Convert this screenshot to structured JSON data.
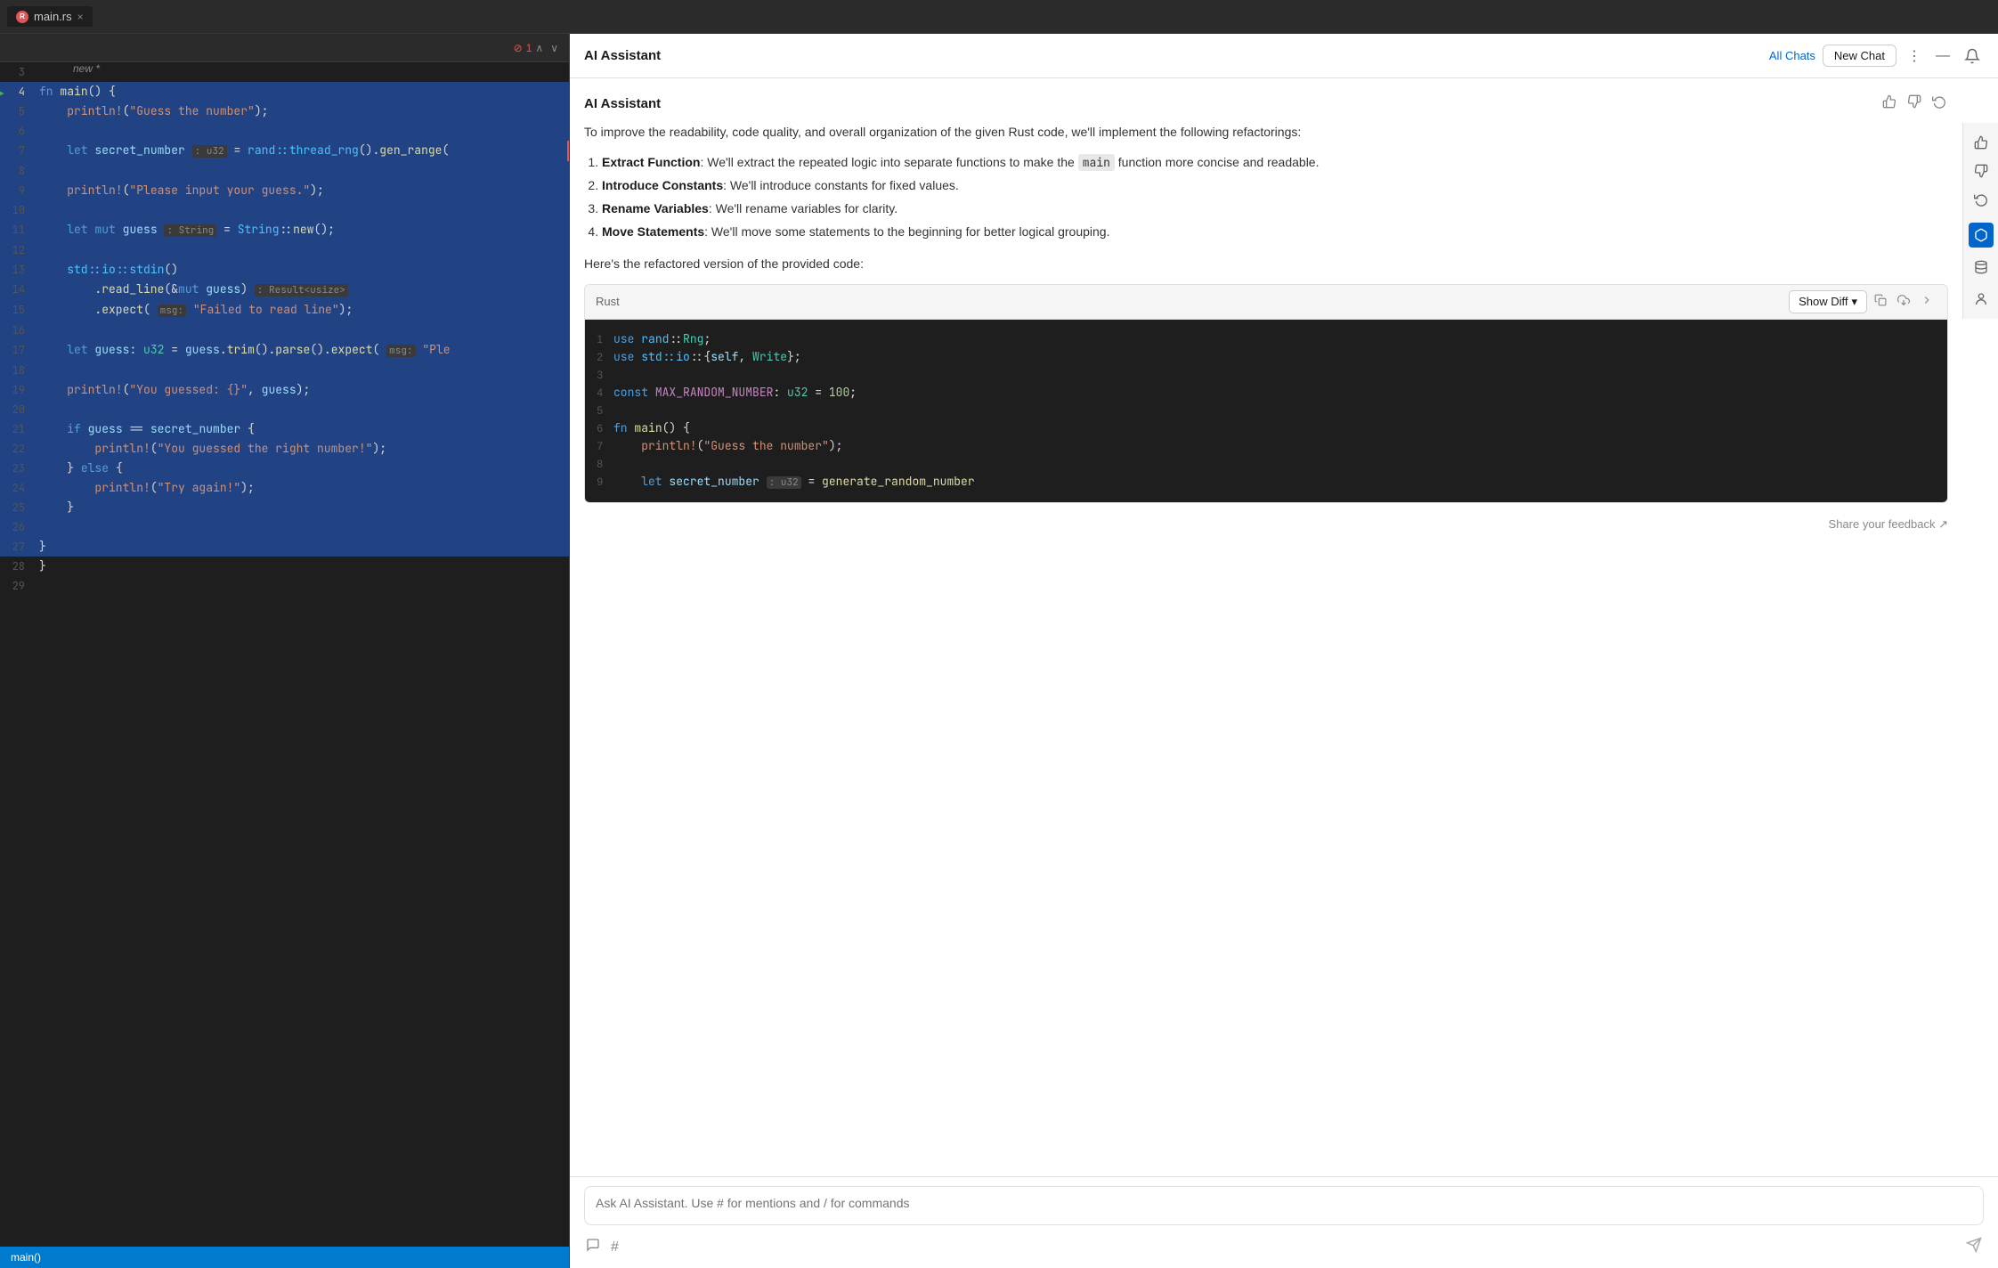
{
  "tab": {
    "icon_label": "R",
    "file_name": "main.rs",
    "close_label": "×"
  },
  "editor": {
    "new_label": "new *",
    "error_count": "⊘ 1",
    "lines": [
      {
        "num": 3,
        "content": "",
        "selected": false
      },
      {
        "num": 4,
        "content": "fn main() {",
        "selected": true,
        "has_run": true
      },
      {
        "num": 5,
        "content": "    println!(\"Guess the number\");",
        "selected": true
      },
      {
        "num": 6,
        "content": "",
        "selected": true
      },
      {
        "num": 7,
        "content": "    let secret_number : u32 = rand::thread_rng().gen_range(",
        "selected": true,
        "has_type": true
      },
      {
        "num": 8,
        "content": "",
        "selected": true
      },
      {
        "num": 9,
        "content": "    println!(\"Please input your guess.\");",
        "selected": true
      },
      {
        "num": 10,
        "content": "",
        "selected": true
      },
      {
        "num": 11,
        "content": "    let mut guess : String = String::new();",
        "selected": true
      },
      {
        "num": 12,
        "content": "",
        "selected": true
      },
      {
        "num": 13,
        "content": "    std::io::stdin()",
        "selected": true
      },
      {
        "num": 14,
        "content": "        .read_line(&mut guess) : Result<usize>",
        "selected": true
      },
      {
        "num": 15,
        "content": "        .expect( msg: \"Failed to read line\");",
        "selected": true
      },
      {
        "num": 16,
        "content": "",
        "selected": true
      },
      {
        "num": 17,
        "content": "    let guess: u32 = guess.trim().parse().expect( msg: \"Ple",
        "selected": true
      },
      {
        "num": 18,
        "content": "",
        "selected": true
      },
      {
        "num": 19,
        "content": "    println!(\"You guessed: {}\", guess);",
        "selected": true
      },
      {
        "num": 20,
        "content": "",
        "selected": true
      },
      {
        "num": 21,
        "content": "    if guess == secret_number {",
        "selected": true
      },
      {
        "num": 22,
        "content": "        println!(\"You guessed the right number!\");",
        "selected": true
      },
      {
        "num": 23,
        "content": "    } else {",
        "selected": true
      },
      {
        "num": 24,
        "content": "        println!(\"Try again!\");",
        "selected": true
      },
      {
        "num": 25,
        "content": "    }",
        "selected": true
      },
      {
        "num": 26,
        "content": "",
        "selected": true
      },
      {
        "num": 27,
        "content": "}",
        "selected": true
      },
      {
        "num": 28,
        "content": "}",
        "selected": false
      },
      {
        "num": 29,
        "content": "",
        "selected": false
      }
    ]
  },
  "status_bar": {
    "text": "main()"
  },
  "ai_panel": {
    "title": "AI Assistant",
    "all_chats_label": "All Chats",
    "new_chat_label": "New Chat",
    "message_title": "AI Assistant",
    "intro_text": "To improve the readability, code quality, and overall organization of the given Rust code, we'll implement the following refactorings:",
    "list_items": [
      {
        "bold": "Extract Function",
        "text": ": We'll extract the repeated logic into separate functions to make the main function more concise and readable."
      },
      {
        "bold": "Introduce Constants",
        "text": ": We'll introduce constants for fixed values."
      },
      {
        "bold": "Rename Variables",
        "text": ": We'll rename variables for clarity."
      },
      {
        "bold": "Move Statements",
        "text": ": We'll move some statements to the beginning for better logical grouping."
      }
    ],
    "refactored_label": "Here's the refactored version of the provided code:",
    "code_lang": "Rust",
    "show_diff_label": "Show Diff",
    "code_lines": [
      {
        "num": 1,
        "content": "use rand::Rng;"
      },
      {
        "num": 2,
        "content": "use std::io::{self, Write};"
      },
      {
        "num": 3,
        "content": ""
      },
      {
        "num": 4,
        "content": "const MAX_RANDOM_NUMBER: u32 = 100;"
      },
      {
        "num": 5,
        "content": ""
      },
      {
        "num": 6,
        "content": "fn main() {"
      },
      {
        "num": 7,
        "content": "    println!(\"Guess the number\");"
      },
      {
        "num": 8,
        "content": ""
      },
      {
        "num": 9,
        "content": "    let secret_number : u32 = generate_random_number"
      }
    ],
    "feedback_text": "Share your feedback ↗",
    "input_placeholder": "Ask AI Assistant. Use # for mentions and / for commands"
  }
}
